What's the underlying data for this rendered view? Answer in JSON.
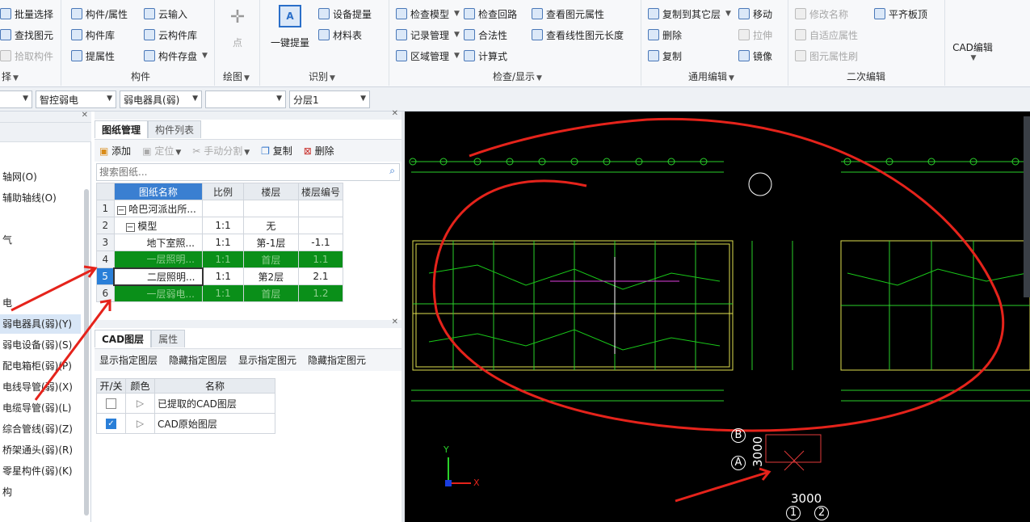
{
  "ribbon": {
    "select_group": {
      "label": "择",
      "items": [
        "批量选择",
        "查找图元",
        "拾取构件"
      ]
    },
    "component_group": {
      "label": "构件",
      "items": [
        "构件/属性",
        "构件库",
        "提属性",
        "云输入",
        "云构件库",
        "构件存盘"
      ]
    },
    "draw_group": {
      "label": "绘图",
      "point": "点"
    },
    "identify_group": {
      "label": "识别",
      "one_click": "一键提量",
      "device_extract": "设备提量",
      "material_table": "材料表"
    },
    "check_group": {
      "label": "检查/显示",
      "items": [
        "检查模型",
        "检查回路",
        "查看图元属性",
        "记录管理",
        "合法性",
        "查看线性图元长度",
        "区域管理",
        "计算式"
      ]
    },
    "edit_group": {
      "label": "通用编辑",
      "items": [
        "复制到其它层",
        "移动",
        "删除",
        "拉伸",
        "复制",
        "镜像"
      ]
    },
    "secondary_group": {
      "label": "二次编辑",
      "items": [
        "修改名称",
        "平齐板顶",
        "自适应属性",
        "图元属性刷"
      ]
    },
    "cad_edit": "CAD编辑"
  },
  "toolbar": {
    "dropdowns": [
      "",
      "智控弱电",
      "弱电器具(弱)",
      "",
      "分层1"
    ]
  },
  "left_panel": {
    "items": [
      "轴网(O)",
      "辅助轴线(O)",
      "气",
      "电",
      "弱电器具(弱)(Y)",
      "弱电设备(弱)(S)",
      "配电箱柜(弱)(P)",
      "电线导管(弱)(X)",
      "电缆导管(弱)(L)",
      "综合管线(弱)(Z)",
      "桥架通头(弱)(R)",
      "零星构件(弱)(K)",
      "构"
    ]
  },
  "drawing_panel": {
    "tabs": [
      "图纸管理",
      "构件列表"
    ],
    "actions": [
      "添加",
      "定位",
      "手动分割",
      "复制",
      "删除"
    ],
    "search_placeholder": "搜索图纸...",
    "columns": [
      "图纸名称",
      "比例",
      "楼层",
      "楼层编号"
    ],
    "rows": [
      {
        "num": "1",
        "name": "哈巴河派出所...",
        "scale": "",
        "floor": "",
        "code": ""
      },
      {
        "num": "2",
        "name": "模型",
        "scale": "1:1",
        "floor": "无",
        "code": ""
      },
      {
        "num": "3",
        "name": "地下室照...",
        "scale": "1:1",
        "floor": "第-1层",
        "code": "-1.1"
      },
      {
        "num": "4",
        "name": "一层照明...",
        "scale": "1:1",
        "floor": "首层",
        "code": "1.1"
      },
      {
        "num": "5",
        "name": "二层照明...",
        "scale": "1:1",
        "floor": "第2层",
        "code": "2.1"
      },
      {
        "num": "6",
        "name": "一层弱电...",
        "scale": "1:1",
        "floor": "首层",
        "code": "1.2"
      }
    ]
  },
  "cad_panel": {
    "tabs": [
      "CAD图层",
      "属性"
    ],
    "actions": [
      "显示指定图层",
      "隐藏指定图层",
      "显示指定图元",
      "隐藏指定图元"
    ],
    "columns": [
      "开/关",
      "颜色",
      "名称"
    ],
    "layers": [
      {
        "checked": false,
        "name": "已提取的CAD图层"
      },
      {
        "checked": true,
        "name": "CAD原始图层"
      }
    ]
  },
  "canvas": {
    "label_b": "B",
    "label_a": "A",
    "dim_vertical": "3000",
    "dim_horizontal": "3000",
    "axis_1": "1",
    "axis_2": "2",
    "axis_x": "X",
    "axis_y": "Y"
  }
}
